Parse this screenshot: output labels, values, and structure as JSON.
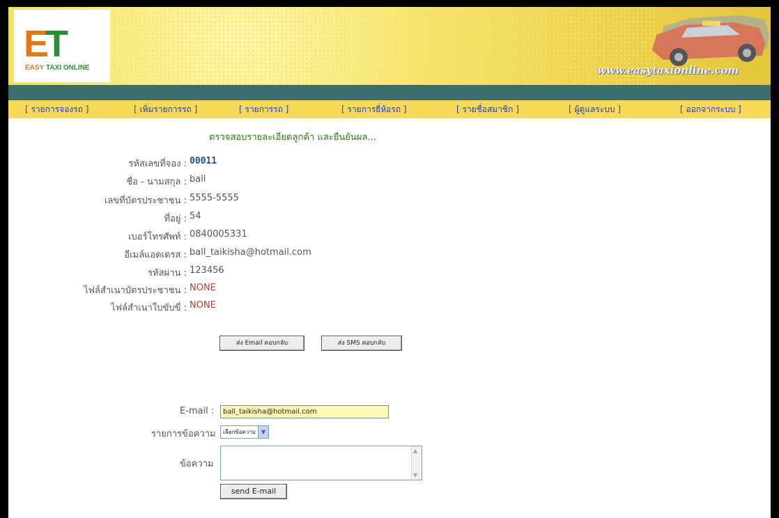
{
  "banner": {
    "logo_letters_e": "E",
    "logo_letters_t": "T",
    "logo_word_easy": "EASY",
    "logo_word_rest": " TAXI ONLINE",
    "site_url": "www.easytaxionline.com"
  },
  "nav": {
    "items": [
      "[ รายการจองรถ ]",
      "[ เพิ่มรายการรถ ]",
      "[ รายการรถ ]",
      "[ รายการยี่ห้อรถ ]",
      "[ รายชื่อสมาชิก ]",
      "[ ผู้ดูแลระบบ ]",
      "[ ออกจากระบบ ]"
    ]
  },
  "details": {
    "title": "ตรวจสอบรายละเอียดลูกค้า และยืนยันผล...",
    "booking_id_label": "รหัสเลขที่จอง :",
    "booking_id": "00011",
    "name_label": "ชื่อ - นามสกุล :",
    "name": "ball",
    "id_card_label": "เลขที่บัตรประชาชน :",
    "id_card": "5555-5555",
    "address_label": "ที่อยู่ :",
    "address": "54",
    "phone_label": "เบอร์โทรศัพท์ :",
    "phone": "0840005331",
    "email_label": "อีเมล์แอดเดรส :",
    "email": "ball_taikisha@hotmail.com",
    "password_label": "รหัสผ่าน :",
    "password": "123456",
    "id_copy_label": "ไฟล์สำเนาบัตรประชาชน :",
    "id_copy": "NONE",
    "license_copy_label": "ไฟล์สำเนาใบขับขี่ :",
    "license_copy": "NONE"
  },
  "actions": {
    "email_reply": "ส่ง Email ตอบกลับ",
    "sms_reply": "ส่ง SMS ตอบกลับ"
  },
  "form": {
    "email_label": "E-mail :",
    "email_value": "ball_taikisha@hotmail.com",
    "message_list_label": "รายการข้อความ",
    "message_select": "เลือกข้อความ",
    "message_label": "ข้อความ",
    "send_button": "send E-mail"
  }
}
